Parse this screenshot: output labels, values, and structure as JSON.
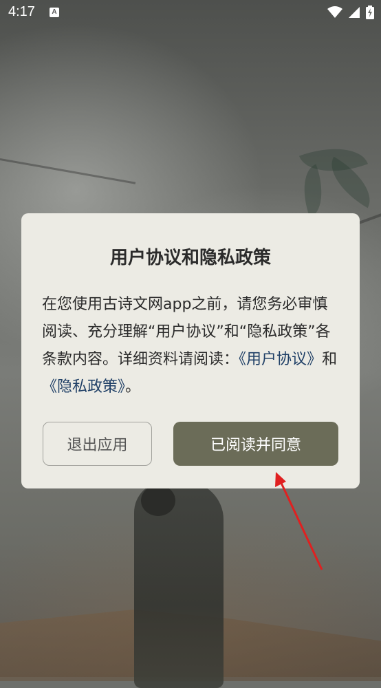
{
  "status_bar": {
    "time": "4:17",
    "a_icon_label": "A"
  },
  "dialog": {
    "title": "用户协议和隐私政策",
    "body_text": "在您使用古诗文网app之前，请您务必审慎阅读、充分理解“用户协议”和“隐私政策”各条款内容。详细资料请阅读：",
    "link_open_1": "《",
    "link_user_agreement": "用户协议",
    "link_close_1": "》",
    "and_text": "和",
    "link_open_2": "《",
    "link_privacy_policy": "隐私政策",
    "link_close_2": "》",
    "period": "。",
    "exit_button": "退出应用",
    "agree_button": "已阅读并同意"
  },
  "colors": {
    "dialog_bg": "#ecebe4",
    "agree_button_bg": "#6b6c58",
    "link_color": "#1f3f66",
    "arrow_color": "#e02020"
  },
  "icons": [
    "a-notification-icon",
    "wifi-icon",
    "cell-signal-icon",
    "battery-charging-icon"
  ]
}
